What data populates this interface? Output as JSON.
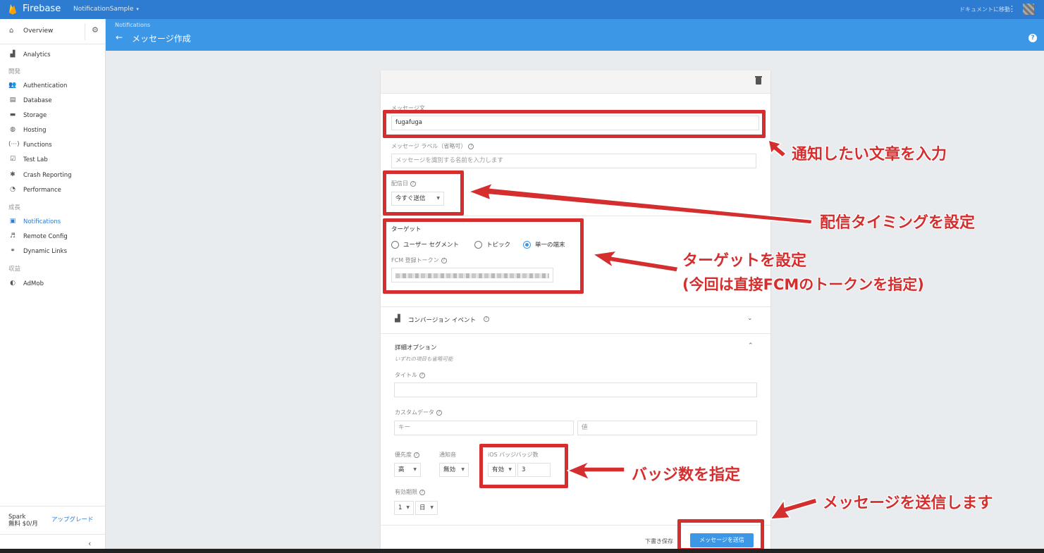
{
  "topbar": {
    "brand": "Firebase",
    "project": "NotificationSample",
    "project_caret": "▾",
    "docs_link": "ドキュメントに移動",
    "kebab": "⋮"
  },
  "header": {
    "breadcrumb": "Notifications",
    "back_arrow": "←",
    "title": "メッセージ作成",
    "help": "?"
  },
  "sidebar": {
    "overview": "Overview",
    "items_top": [
      {
        "label": "Analytics",
        "icon": "bar-chart"
      }
    ],
    "section_develop": "開発",
    "develop": [
      {
        "label": "Authentication",
        "icon": "people"
      },
      {
        "label": "Database",
        "icon": "database"
      },
      {
        "label": "Storage",
        "icon": "folder-image"
      },
      {
        "label": "Hosting",
        "icon": "globe"
      },
      {
        "label": "Functions",
        "icon": "braces"
      },
      {
        "label": "Test Lab",
        "icon": "checklist"
      },
      {
        "label": "Crash Reporting",
        "icon": "bug"
      },
      {
        "label": "Performance",
        "icon": "speedometer"
      }
    ],
    "section_grow": "成長",
    "grow": [
      {
        "label": "Notifications",
        "icon": "message"
      },
      {
        "label": "Remote Config",
        "icon": "tune"
      },
      {
        "label": "Dynamic Links",
        "icon": "link"
      }
    ],
    "section_earn": "収益",
    "earn": [
      {
        "label": "AdMob",
        "icon": "admob"
      }
    ],
    "plan_name": "Spark",
    "plan_price": "無料 $0/月",
    "upgrade": "アップグレード",
    "collapse": "‹"
  },
  "form": {
    "message_text_label": "メッセージ文",
    "message_text_value": "fugafuga",
    "message_label_label": "メッセージ ラベル（省略可）",
    "message_label_placeholder": "メッセージを識別する名前を入力します",
    "delivery_date_label": "配信日",
    "delivery_date_value": "今すぐ送信",
    "target_label": "ターゲット",
    "target_options": [
      "ユーザー セグメント",
      "トピック",
      "単一の端末"
    ],
    "target_selected": "単一の端末",
    "fcm_token_label": "FCM 登録トークン",
    "conversion_event_label": "コンバージョン イベント",
    "advanced_label": "詳細オプション",
    "advanced_hint": "いずれの項目も省略可能",
    "title_label": "タイトル",
    "custom_data_label": "カスタムデータ",
    "key_placeholder": "キー",
    "value_placeholder": "値",
    "priority_label": "優先度",
    "priority_value": "高",
    "sound_label": "通知音",
    "sound_value": "無効",
    "badge_label": "iOS バッジバッジ数",
    "badge_enabled_value": "有効",
    "badge_count": "3",
    "expiry_label": "有効期限",
    "expiry_value": "1",
    "expiry_unit": "日",
    "draft_button": "下書き保存",
    "send_button": "メッセージを送信"
  },
  "annotations": {
    "input_text": "通知したい文章を入力",
    "timing": "配信タイミングを設定",
    "target_line1": "ターゲットを設定",
    "target_line2": "(今回は直接FCMのトークンを指定)",
    "badge": "バッジ数を指定",
    "send": "メッセージを送信します",
    "color": "#d42e2e"
  }
}
